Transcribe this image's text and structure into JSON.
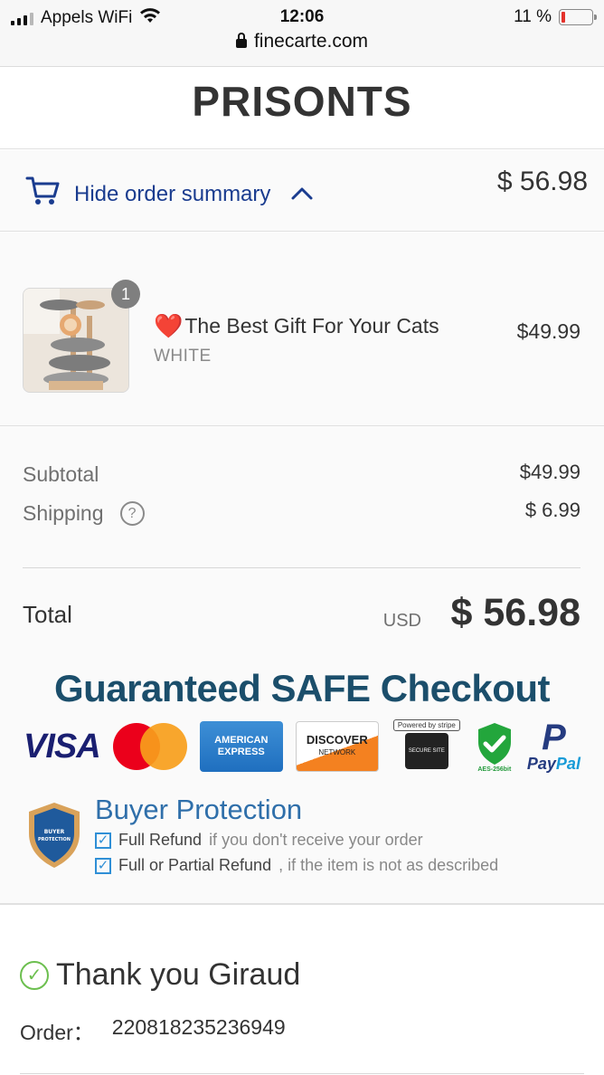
{
  "status_bar": {
    "carrier": "Appels WiFi",
    "time": "12:06",
    "battery": "11 %",
    "battery_level": 0.11,
    "url": "finecarte.com"
  },
  "header": {
    "title": "PRISONTS"
  },
  "summary_toggle": {
    "label": "Hide order summary",
    "total": "$ 56.98",
    "icon": "cart-icon",
    "chevron": "chevron-up-icon"
  },
  "product": {
    "quantity": "1",
    "heart": "❤️",
    "name": "The Best Gift For Your Cats",
    "variant": "WHITE",
    "price": "$49.99"
  },
  "totals": {
    "subtotal_label": "Subtotal",
    "subtotal_value": "$49.99",
    "shipping_label": "Shipping",
    "shipping_value": "$ 6.99",
    "total_label": "Total",
    "currency": "USD",
    "total_value": "$ 56.98"
  },
  "guarantee": {
    "title": "Guaranteed SAFE Checkout",
    "visa": "VISA",
    "amex_line1": "AMERICAN",
    "amex_line2": "EXPRESS",
    "discover": "DISCOVER",
    "discover_sub": "NETWORK",
    "stripe_tag": "Powered by stripe",
    "stripe_sub": "SECURE SITE",
    "aes": "AES-256bit",
    "paypal_pay": "Pay",
    "paypal_pal": "Pal"
  },
  "buyer_protection": {
    "title": "Buyer Protection",
    "badge_text": "BUYER PROTECTION",
    "line1_strong": "Full Refund",
    "line1_rest": "if you don't receive your order",
    "line2_strong": "Full or Partial Refund",
    "line2_rest": ", if the item is not as described"
  },
  "thanks": {
    "message": "Thank you Giraud",
    "order_label": "Order：",
    "order_number": "220818235236949"
  },
  "colors": {
    "link": "#1a3c8f",
    "guarantee": "#1b4e6b",
    "protection": "#2f6faa",
    "success": "#6cbf4f",
    "battery_low": "#e4312b"
  }
}
